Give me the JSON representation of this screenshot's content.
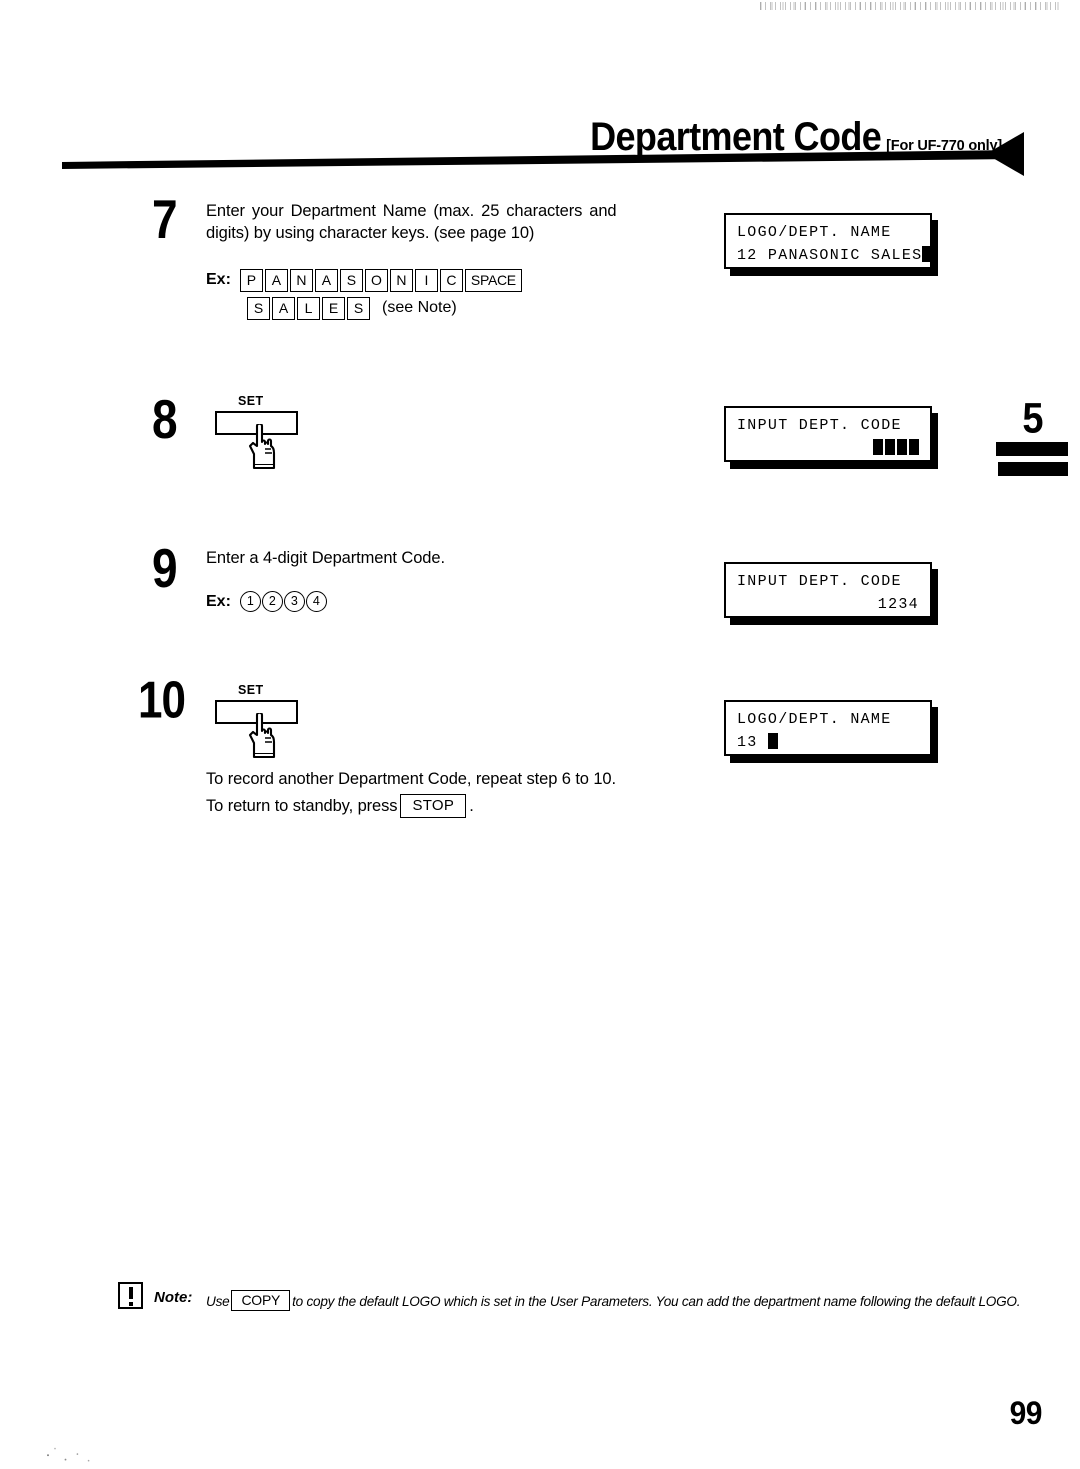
{
  "header": {
    "title": "Department Code",
    "subtitle": "[For UF-770 only]",
    "arrow_icon": "left-triangle-arrow-icon"
  },
  "chapter_tab": {
    "number": "5"
  },
  "page_number": "99",
  "steps": [
    {
      "number": "7",
      "text_line1": "Enter your Department Name (max. 25 characters and",
      "text_line2": "digits) by using character keys.  (see page 10)",
      "example_label": "Ex:",
      "example_keys_row1": [
        "P",
        "A",
        "N",
        "A",
        "S",
        "O",
        "N",
        "I",
        "C",
        "SPACE"
      ],
      "example_keys_row2": [
        "S",
        "A",
        "L",
        "E",
        "S"
      ],
      "example_note": "(see Note)",
      "lcd": {
        "line1": "LOGO/DEPT. NAME",
        "line2": "12 PANASONIC SALES",
        "cursor_blocks": 1
      }
    },
    {
      "number": "8",
      "key_label": "SET",
      "hand_icon": "pointing-hand-icon",
      "lcd": {
        "line1": "INPUT DEPT. CODE",
        "line2": "",
        "cursor_blocks": 4
      }
    },
    {
      "number": "9",
      "text_line1": "Enter a 4-digit Department Code.",
      "example_label": "Ex:",
      "example_digits": [
        "1",
        "2",
        "3",
        "4"
      ],
      "lcd": {
        "line1": "INPUT DEPT. CODE",
        "line2": "1234",
        "cursor_blocks": 0
      }
    },
    {
      "number": "10",
      "key_label": "SET",
      "hand_icon": "pointing-hand-icon",
      "text_line1": "To record another Department Code, repeat step 6 to 10.",
      "text_line2_pre": "To return to standby, press",
      "text_line2_key": "STOP",
      "text_line2_post": ".",
      "lcd": {
        "line1": "LOGO/DEPT. NAME",
        "line2": "13 ",
        "cursor_blocks": 1
      }
    }
  ],
  "note": {
    "icon": "exclamation-box-icon",
    "label": "Note:",
    "text_pre": "Use",
    "key": "COPY",
    "text_post": "to copy the default LOGO which is set in the User Parameters. You can add the department name following the default LOGO."
  }
}
